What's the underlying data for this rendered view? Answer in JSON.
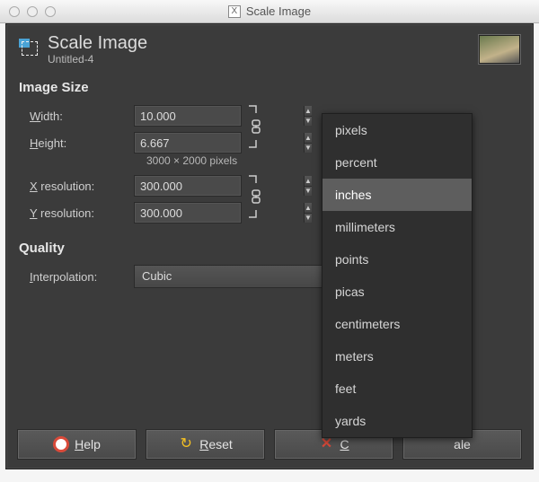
{
  "window": {
    "title": "Scale Image"
  },
  "header": {
    "title": "Scale Image",
    "subtitle": "Untitled-4"
  },
  "image_size": {
    "label": "Image Size",
    "width_label_pre": "W",
    "width_label_rest": "idth:",
    "height_label_pre": "H",
    "height_label_rest": "eight:",
    "width_value": "10.000",
    "height_value": "6.667",
    "pixels_note": "3000 × 2000 pixels",
    "xres_label_pre": "X",
    "xres_label_rest": " resolution:",
    "yres_label_pre": "Y",
    "yres_label_rest": " resolution:",
    "xres_value": "300.000",
    "yres_value": "300.000"
  },
  "quality": {
    "label": "Quality",
    "interp_label_pre": "I",
    "interp_label_rest": "nterpolation:",
    "interp_value": "Cubic"
  },
  "buttons": {
    "help_pre": "H",
    "help_rest": "elp",
    "reset_pre": "R",
    "reset_rest": "eset",
    "cancel_pre": "C",
    "scale_rest": "ale"
  },
  "units_menu": {
    "items": [
      "pixels",
      "percent",
      "inches",
      "millimeters",
      "points",
      "picas",
      "centimeters",
      "meters",
      "feet",
      "yards"
    ],
    "selected": "inches"
  }
}
